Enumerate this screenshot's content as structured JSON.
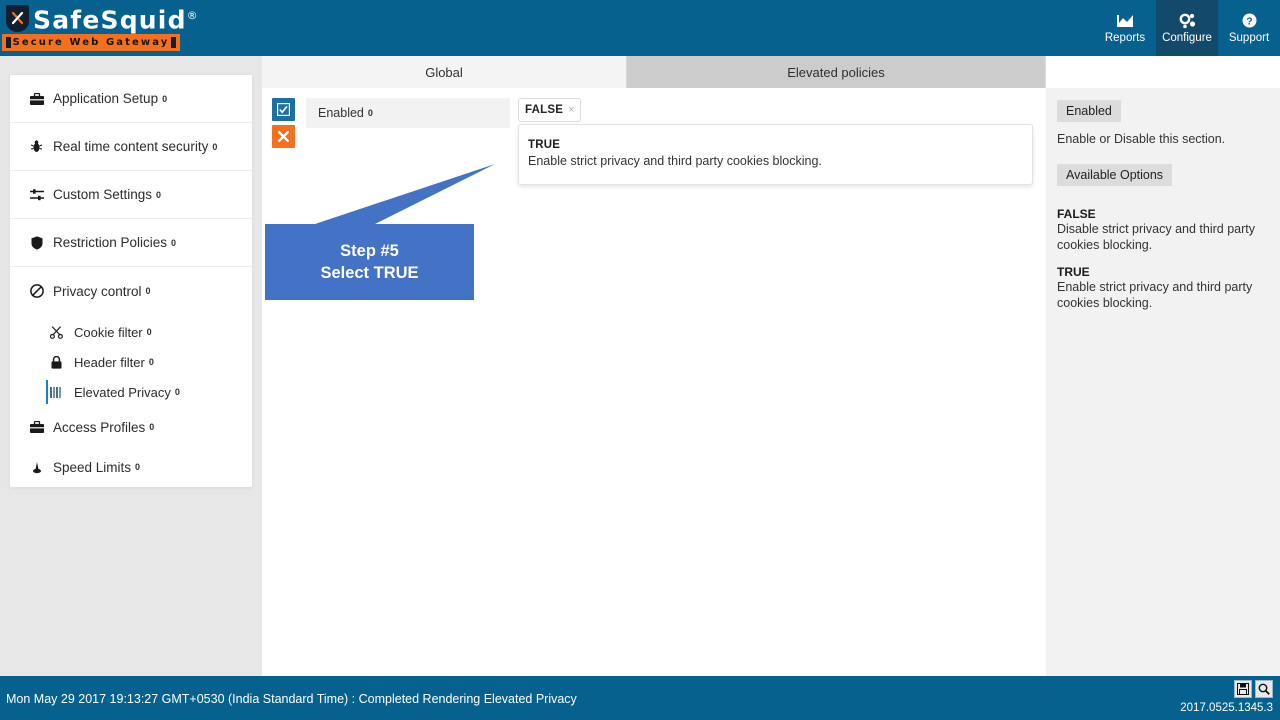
{
  "brand": {
    "name": "SafeSquid",
    "registered": "®",
    "tagline": "Secure Web Gateway",
    "shield_icon": "shield-tools-icon"
  },
  "colors": {
    "header_blue": "#06618f",
    "active_nav": "#134a6b",
    "orange": "#f4701f",
    "callout_blue": "#4472c4",
    "accent_select": "#1c7fc0",
    "check_button": "#1b6fa3"
  },
  "header": {
    "nav": [
      {
        "label": "Reports",
        "icon": "chart-icon",
        "active": false
      },
      {
        "label": "Configure",
        "icon": "gears-icon",
        "active": true
      },
      {
        "label": "Support",
        "icon": "question-circle-icon",
        "active": false
      }
    ]
  },
  "sidebar": {
    "items": [
      {
        "label": "Application Setup",
        "badge": "0",
        "icon": "briefcase-icon",
        "level": 0,
        "selected": false
      },
      {
        "label": "Real time content security",
        "badge": "0",
        "icon": "bug-icon",
        "level": 0,
        "selected": false
      },
      {
        "label": "Custom Settings",
        "badge": "0",
        "icon": "sliders-icon",
        "level": 0,
        "selected": false
      },
      {
        "label": "Restriction Policies",
        "badge": "0",
        "icon": "shield-icon",
        "level": 0,
        "selected": false
      },
      {
        "label": "Privacy control",
        "badge": "0",
        "icon": "ban-icon",
        "level": 0,
        "selected": false
      },
      {
        "label": "Cookie filter",
        "badge": "0",
        "icon": "scissors-icon",
        "level": 1,
        "selected": false
      },
      {
        "label": "Header filter",
        "badge": "0",
        "icon": "lock-icon",
        "level": 1,
        "selected": false
      },
      {
        "label": "Elevated Privacy",
        "badge": "0",
        "icon": "bars-icon",
        "level": 1,
        "selected": true
      },
      {
        "label": "Access Profiles",
        "badge": "0",
        "icon": "briefcase-icon",
        "level": 0,
        "selected": false
      },
      {
        "label": "Speed Limits",
        "badge": "0",
        "icon": "tachometer-icon",
        "level": 0,
        "selected": false
      }
    ]
  },
  "tabs": [
    {
      "label": "Global",
      "active": true
    },
    {
      "label": "Elevated policies",
      "active": false
    }
  ],
  "form": {
    "check_button_icon": "checkbox-checked-icon",
    "delete_button_icon": "close-x-icon",
    "field_label": "Enabled",
    "field_badge": "0",
    "selected_value": "FALSE",
    "remove_tag_icon": "remove-tag-x-icon",
    "dropdown": {
      "option_title": "TRUE",
      "option_desc": "Enable strict privacy and third party cookies blocking."
    }
  },
  "callout": {
    "line1": "Step #5",
    "line2": "Select TRUE"
  },
  "help": {
    "section_heading": "Enabled",
    "section_desc": "Enable or Disable this section.",
    "options_heading": "Available Options",
    "options": [
      {
        "title": "FALSE",
        "desc": "Disable strict privacy and third party cookies blocking."
      },
      {
        "title": "TRUE",
        "desc": "Enable strict privacy and third party cookies blocking."
      }
    ]
  },
  "footer": {
    "message": "Mon May 29 2017 19:13:27 GMT+0530 (India Standard Time) : Completed Rendering Elevated Privacy",
    "version": "2017.0525.1345.3",
    "save_icon": "save-floppy-icon",
    "search_icon": "search-magnifier-icon"
  }
}
